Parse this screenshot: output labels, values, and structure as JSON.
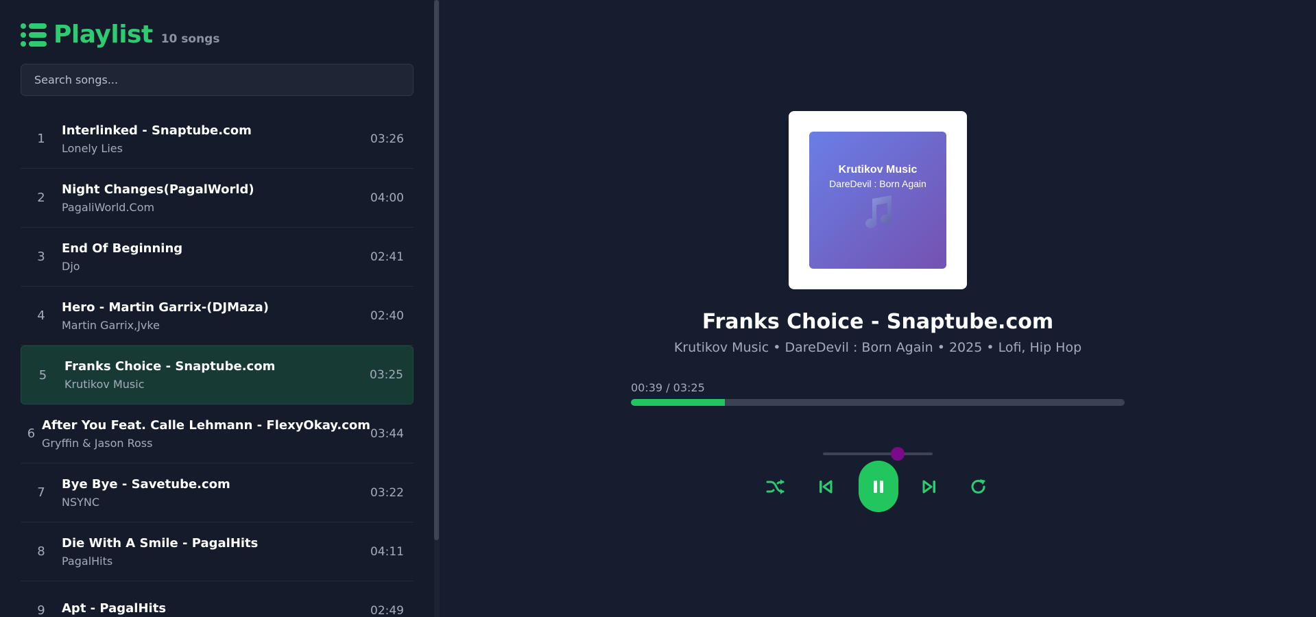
{
  "sidebar": {
    "title": "Playlist",
    "song_count": "10 songs",
    "search_placeholder": "Search songs...",
    "songs": [
      {
        "num": "1",
        "title": "Interlinked - Snaptube.com",
        "artist": "Lonely Lies",
        "duration": "03:26"
      },
      {
        "num": "2",
        "title": "Night Changes(PagalWorld)",
        "artist": "PagaliWorld.Com",
        "duration": "04:00"
      },
      {
        "num": "3",
        "title": "End Of Beginning",
        "artist": "Djo",
        "duration": "02:41"
      },
      {
        "num": "4",
        "title": "Hero - Martin Garrix-(DJMaza)",
        "artist": "Martin Garrix,Jvke",
        "duration": "02:40"
      },
      {
        "num": "5",
        "title": "Franks Choice - Snaptube.com",
        "artist": "Krutikov Music",
        "duration": "03:25",
        "active": true
      },
      {
        "num": "6",
        "title": "After You Feat. Calle Lehmann - FlexyOkay.com",
        "artist": "Gryffin & Jason Ross",
        "duration": "03:44"
      },
      {
        "num": "7",
        "title": "Bye Bye - Savetube.com",
        "artist": "NSYNC",
        "duration": "03:22"
      },
      {
        "num": "8",
        "title": "Die With A Smile - PagalHits",
        "artist": "PagalHits",
        "duration": "04:11"
      },
      {
        "num": "9",
        "title": "Apt - PagalHits",
        "artist": "",
        "duration": "02:49"
      }
    ]
  },
  "player": {
    "album_art": {
      "artist": "Krutikov Music",
      "album": "DareDevil : Born Again"
    },
    "now_playing_title": "Franks Choice - Snaptube.com",
    "now_playing_meta": "Krutikov Music • DareDevil : Born Again • 2025 • Lofi, Hip Hop",
    "time_readout": "00:39 / 03:25",
    "progress_fraction": 0.19,
    "volume_fraction": 0.68,
    "controls": [
      "shuffle-icon",
      "previous-icon",
      "pause-icon",
      "next-icon",
      "repeat-icon"
    ]
  },
  "colors": {
    "accent": "#22c55e",
    "background": "#161d2e",
    "sidebar_bg": "#151b2b",
    "active_row": "#183a35",
    "volume_thumb": "#7a0a8a",
    "art_gradient_start": "#6a7ee6",
    "art_gradient_end": "#7452b0"
  }
}
